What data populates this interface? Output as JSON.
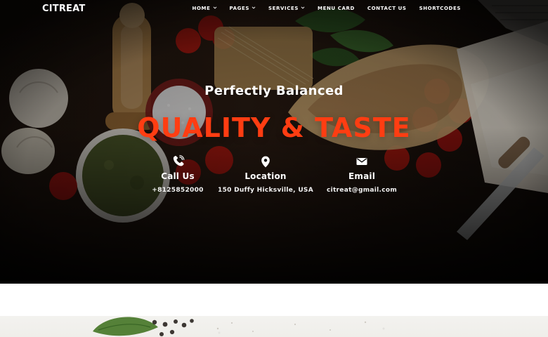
{
  "brand": {
    "name": "CITREAT"
  },
  "nav": {
    "items": [
      {
        "label": "HOME",
        "has_dropdown": true
      },
      {
        "label": "PAGES",
        "has_dropdown": true
      },
      {
        "label": "SERVICES",
        "has_dropdown": true
      },
      {
        "label": "MENU CARD",
        "has_dropdown": false
      },
      {
        "label": "CONTACT US",
        "has_dropdown": false
      },
      {
        "label": "SHORTCODES",
        "has_dropdown": false
      }
    ]
  },
  "hero": {
    "kicker": "Perfectly Balanced",
    "headline": "QUALITY & TASTE",
    "contacts": [
      {
        "title": "Call Us",
        "value": "+8125852000",
        "icon": "phone-icon"
      },
      {
        "title": "Location",
        "value": "150 Duffy Hicksville, USA",
        "icon": "map-pin-icon"
      },
      {
        "title": "Email",
        "value": "citreat@gmail.com",
        "icon": "mail-icon"
      }
    ]
  },
  "colors": {
    "accent": "#ff3d12",
    "nav_text": "#ffffff",
    "hero_dark": "#0b0908",
    "white_section": "#ffffff",
    "lower_texture": "#efeeea"
  }
}
